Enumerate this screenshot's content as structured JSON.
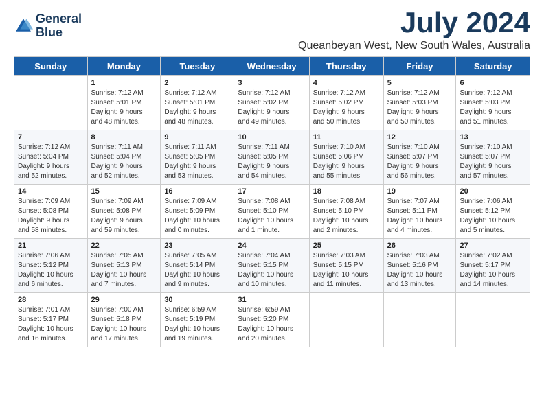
{
  "header": {
    "logo_line1": "General",
    "logo_line2": "Blue",
    "title": "July 2024",
    "subtitle": "Queanbeyan West, New South Wales, Australia"
  },
  "weekdays": [
    "Sunday",
    "Monday",
    "Tuesday",
    "Wednesday",
    "Thursday",
    "Friday",
    "Saturday"
  ],
  "weeks": [
    [
      {
        "day": "",
        "info": ""
      },
      {
        "day": "1",
        "info": "Sunrise: 7:12 AM\nSunset: 5:01 PM\nDaylight: 9 hours\nand 48 minutes."
      },
      {
        "day": "2",
        "info": "Sunrise: 7:12 AM\nSunset: 5:01 PM\nDaylight: 9 hours\nand 48 minutes."
      },
      {
        "day": "3",
        "info": "Sunrise: 7:12 AM\nSunset: 5:02 PM\nDaylight: 9 hours\nand 49 minutes."
      },
      {
        "day": "4",
        "info": "Sunrise: 7:12 AM\nSunset: 5:02 PM\nDaylight: 9 hours\nand 50 minutes."
      },
      {
        "day": "5",
        "info": "Sunrise: 7:12 AM\nSunset: 5:03 PM\nDaylight: 9 hours\nand 50 minutes."
      },
      {
        "day": "6",
        "info": "Sunrise: 7:12 AM\nSunset: 5:03 PM\nDaylight: 9 hours\nand 51 minutes."
      }
    ],
    [
      {
        "day": "7",
        "info": "Sunrise: 7:12 AM\nSunset: 5:04 PM\nDaylight: 9 hours\nand 52 minutes."
      },
      {
        "day": "8",
        "info": "Sunrise: 7:11 AM\nSunset: 5:04 PM\nDaylight: 9 hours\nand 52 minutes."
      },
      {
        "day": "9",
        "info": "Sunrise: 7:11 AM\nSunset: 5:05 PM\nDaylight: 9 hours\nand 53 minutes."
      },
      {
        "day": "10",
        "info": "Sunrise: 7:11 AM\nSunset: 5:05 PM\nDaylight: 9 hours\nand 54 minutes."
      },
      {
        "day": "11",
        "info": "Sunrise: 7:10 AM\nSunset: 5:06 PM\nDaylight: 9 hours\nand 55 minutes."
      },
      {
        "day": "12",
        "info": "Sunrise: 7:10 AM\nSunset: 5:07 PM\nDaylight: 9 hours\nand 56 minutes."
      },
      {
        "day": "13",
        "info": "Sunrise: 7:10 AM\nSunset: 5:07 PM\nDaylight: 9 hours\nand 57 minutes."
      }
    ],
    [
      {
        "day": "14",
        "info": "Sunrise: 7:09 AM\nSunset: 5:08 PM\nDaylight: 9 hours\nand 58 minutes."
      },
      {
        "day": "15",
        "info": "Sunrise: 7:09 AM\nSunset: 5:08 PM\nDaylight: 9 hours\nand 59 minutes."
      },
      {
        "day": "16",
        "info": "Sunrise: 7:09 AM\nSunset: 5:09 PM\nDaylight: 10 hours\nand 0 minutes."
      },
      {
        "day": "17",
        "info": "Sunrise: 7:08 AM\nSunset: 5:10 PM\nDaylight: 10 hours\nand 1 minute."
      },
      {
        "day": "18",
        "info": "Sunrise: 7:08 AM\nSunset: 5:10 PM\nDaylight: 10 hours\nand 2 minutes."
      },
      {
        "day": "19",
        "info": "Sunrise: 7:07 AM\nSunset: 5:11 PM\nDaylight: 10 hours\nand 4 minutes."
      },
      {
        "day": "20",
        "info": "Sunrise: 7:06 AM\nSunset: 5:12 PM\nDaylight: 10 hours\nand 5 minutes."
      }
    ],
    [
      {
        "day": "21",
        "info": "Sunrise: 7:06 AM\nSunset: 5:12 PM\nDaylight: 10 hours\nand 6 minutes."
      },
      {
        "day": "22",
        "info": "Sunrise: 7:05 AM\nSunset: 5:13 PM\nDaylight: 10 hours\nand 7 minutes."
      },
      {
        "day": "23",
        "info": "Sunrise: 7:05 AM\nSunset: 5:14 PM\nDaylight: 10 hours\nand 9 minutes."
      },
      {
        "day": "24",
        "info": "Sunrise: 7:04 AM\nSunset: 5:15 PM\nDaylight: 10 hours\nand 10 minutes."
      },
      {
        "day": "25",
        "info": "Sunrise: 7:03 AM\nSunset: 5:15 PM\nDaylight: 10 hours\nand 11 minutes."
      },
      {
        "day": "26",
        "info": "Sunrise: 7:03 AM\nSunset: 5:16 PM\nDaylight: 10 hours\nand 13 minutes."
      },
      {
        "day": "27",
        "info": "Sunrise: 7:02 AM\nSunset: 5:17 PM\nDaylight: 10 hours\nand 14 minutes."
      }
    ],
    [
      {
        "day": "28",
        "info": "Sunrise: 7:01 AM\nSunset: 5:17 PM\nDaylight: 10 hours\nand 16 minutes."
      },
      {
        "day": "29",
        "info": "Sunrise: 7:00 AM\nSunset: 5:18 PM\nDaylight: 10 hours\nand 17 minutes."
      },
      {
        "day": "30",
        "info": "Sunrise: 6:59 AM\nSunset: 5:19 PM\nDaylight: 10 hours\nand 19 minutes."
      },
      {
        "day": "31",
        "info": "Sunrise: 6:59 AM\nSunset: 5:20 PM\nDaylight: 10 hours\nand 20 minutes."
      },
      {
        "day": "",
        "info": ""
      },
      {
        "day": "",
        "info": ""
      },
      {
        "day": "",
        "info": ""
      }
    ]
  ]
}
